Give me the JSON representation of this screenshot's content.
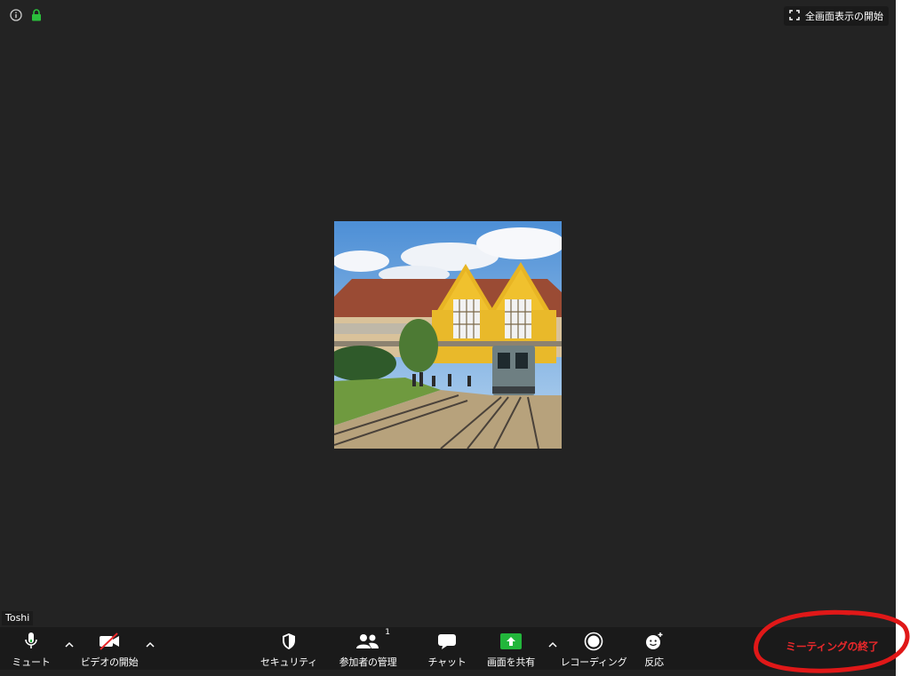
{
  "top": {
    "info_icon": "info-icon",
    "lock_icon": "lock-icon",
    "fullscreen_label": "全画面表示の開始"
  },
  "participant": {
    "name": "Toshi"
  },
  "toolbar": {
    "mute_label": "ミュート",
    "video_label": "ビデオの開始",
    "security_label": "セキュリティ",
    "participants_label": "参加者の管理",
    "participants_count": "1",
    "chat_label": "チャット",
    "share_label": "画面を共有",
    "record_label": "レコーディング",
    "reactions_label": "反応",
    "end_label": "ミーティングの終了"
  },
  "colors": {
    "background": "#232323",
    "toolbar": "#1a1a1a",
    "share_green": "#22b63b",
    "end_red": "#e8282b",
    "annotation_red": "#e01818"
  }
}
